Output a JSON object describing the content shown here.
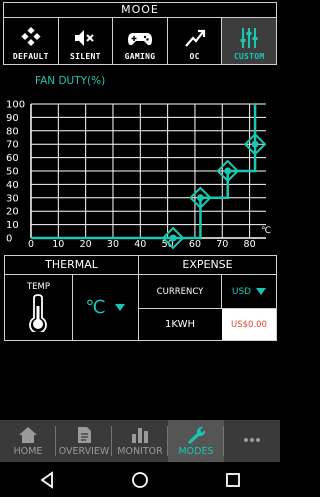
{
  "header": {
    "title": "MOOE"
  },
  "modes": [
    {
      "label": "DEFAULT",
      "icon": "default-mode-icon",
      "active": false
    },
    {
      "label": "SILENT",
      "icon": "mute-speaker-icon",
      "active": false
    },
    {
      "label": "GAMING",
      "icon": "gamepad-icon",
      "active": false
    },
    {
      "label": "OC",
      "icon": "overclock-trend-icon",
      "active": false
    },
    {
      "label": "CUSTOM",
      "icon": "sliders-icon",
      "active": true
    }
  ],
  "chart_data": {
    "type": "line",
    "title": "FAN DUTY(%)",
    "xlabel": "",
    "ylabel": "",
    "x_unit": "℃",
    "x_ticks": [
      0,
      10,
      20,
      30,
      40,
      50,
      60,
      70,
      80
    ],
    "y_ticks": [
      0,
      10,
      20,
      30,
      40,
      50,
      60,
      70,
      80,
      90,
      100
    ],
    "xlim": [
      0,
      86
    ],
    "ylim": [
      0,
      100
    ],
    "grid": true,
    "step": true,
    "series": [
      {
        "x": [
          0,
          52,
          62,
          72,
          82,
          82
        ],
        "y": [
          0,
          0,
          30,
          50,
          70,
          100
        ]
      }
    ],
    "control_points": [
      {
        "x": 52,
        "y": 0
      },
      {
        "x": 62,
        "y": 30
      },
      {
        "x": 72,
        "y": 50
      },
      {
        "x": 82,
        "y": 70
      }
    ],
    "line_color": "#18c9b2"
  },
  "thermal": {
    "header": "THERMAL",
    "temp_label": "TEMP",
    "unit_value": "℃",
    "dropdown_icon": "dropdown-arrow-icon"
  },
  "expense": {
    "header": "EXPENSE",
    "currency_label": "CURRENCY",
    "currency_value": "USD",
    "kwh_label": "1KWH",
    "kwh_value": "US$0.00"
  },
  "tabs": [
    {
      "label": "HOME",
      "icon": "home-icon",
      "active": false
    },
    {
      "label": "OVERVIEW",
      "icon": "document-icon",
      "active": false
    },
    {
      "label": "MONITOR",
      "icon": "bar-chart-icon",
      "active": false
    },
    {
      "label": "MODES",
      "icon": "wrench-icon",
      "active": true
    },
    {
      "label": "",
      "icon": "more-icon",
      "active": false
    }
  ],
  "colors": {
    "accent": "#18c9b2",
    "panel_border": "#cfcfcf"
  }
}
